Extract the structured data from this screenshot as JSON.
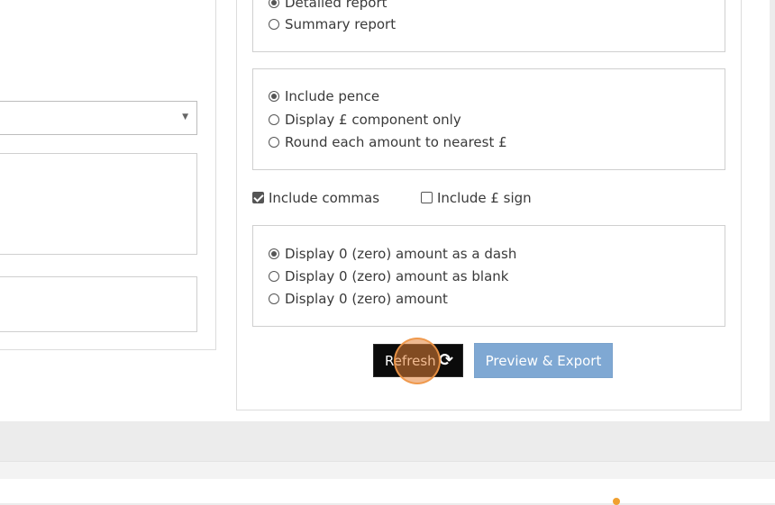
{
  "report_type": {
    "options": [
      {
        "label": "Detailed report",
        "selected": true
      },
      {
        "label": "Summary report",
        "selected": false
      }
    ]
  },
  "pence": {
    "options": [
      {
        "label": "Include pence",
        "selected": true
      },
      {
        "label": "Display £ component only",
        "selected": false
      },
      {
        "label": "Round each amount to nearest £",
        "selected": false
      }
    ]
  },
  "formatting": {
    "commas_label": "Include commas",
    "commas_checked": true,
    "pound_sign_label": "Include £ sign",
    "pound_sign_checked": false
  },
  "zero": {
    "options": [
      {
        "label": "Display 0 (zero) amount as a dash",
        "selected": true
      },
      {
        "label": "Display 0 (zero) amount as blank",
        "selected": false
      },
      {
        "label": "Display 0 (zero) amount",
        "selected": false
      }
    ]
  },
  "actions": {
    "refresh_label": "Refresh",
    "refresh_icon": "refresh-icon",
    "preview_label": "Preview & Export"
  },
  "left": {
    "select_icon": "dropdown-arrow-icon"
  },
  "colors": {
    "refresh_bg": "#0b0b0b",
    "preview_bg": "#7fa8d3",
    "highlight": "#e48236"
  }
}
